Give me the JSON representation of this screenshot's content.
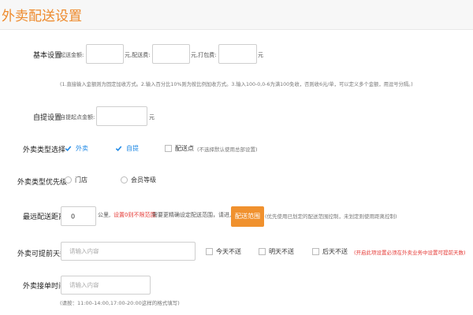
{
  "page": {
    "title": "外卖配送设置"
  },
  "basic": {
    "label": "基本设置",
    "start_label": "起送金额:",
    "unit1": "元,配送费:",
    "unit2": "元,打包费:",
    "unit3": "元",
    "note": "(1.直接输入金额则为固定加收方式。2.输入百分比10%则为按比例加收方式。3.输入100-0,0-6为满100免收，否则收6元/单，可以定义多个金额，用逗号分隔。)"
  },
  "pickup": {
    "label": "自提设置",
    "start_label": "自提起点金额:",
    "unit": "元"
  },
  "type_select": {
    "label": "外卖类型选择",
    "options": [
      {
        "label": "外卖",
        "checked": true
      },
      {
        "label": "自提",
        "checked": true
      },
      {
        "label": "配送点",
        "checked": false
      }
    ],
    "hint": "(不选择默认使用总部设置)"
  },
  "priority": {
    "label": "外卖类型优先级",
    "options": [
      {
        "label": "门店",
        "checked": false
      },
      {
        "label": "会员等级",
        "checked": false
      }
    ]
  },
  "distance": {
    "label": "最远配送距离",
    "value": "0",
    "unit": "公里,",
    "warn": "设置0则不限范围",
    "text1": "需要更精确设定配送范围，请进入",
    "button": "配送范围",
    "text2": "(优先使用已划定的配送范围控制，未划定则使用距离控制)"
  },
  "advance_days": {
    "label": "外卖可提前天数",
    "placeholder": "请输入内容",
    "options": [
      {
        "label": "今天不送",
        "checked": false
      },
      {
        "label": "明天不送",
        "checked": false
      },
      {
        "label": "后天不送",
        "checked": false
      }
    ],
    "warn": "(开启此项设置必须在外卖业务中设置可提前天数)"
  },
  "accept_time": {
    "label": "外卖接单时间",
    "placeholder": "请输入内容",
    "note": "(请按：11:00-14:00,17:00-20:00这样的格式填写)"
  },
  "colors": {
    "accent": "#ee8a2c",
    "button": "#f0912e",
    "check": "#1e88e5",
    "warn": "#e53935"
  }
}
